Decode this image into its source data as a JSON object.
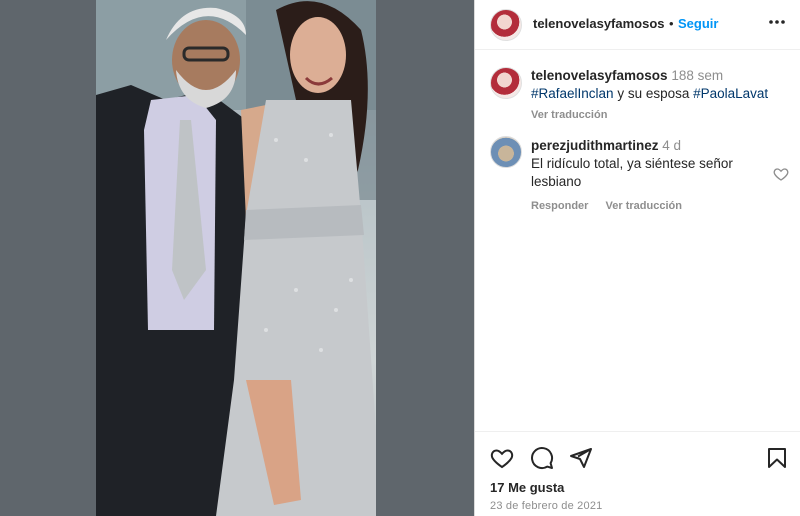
{
  "post": {
    "image_alt": "",
    "likes": "17 Me gusta",
    "date": "23 de febrero de 2021"
  },
  "header": {
    "username": "telenovelasyfamosos",
    "separator": "•",
    "follow_label": "Seguir",
    "more_icon": "more-horizontal-icon"
  },
  "caption": {
    "username": "telenovelasyfamosos",
    "time": "188 sem",
    "tag1": "#RafaelInclan",
    "middle_text": " y su esposa ",
    "tag2": "#PaolaLavat",
    "translate_label": "Ver traducción"
  },
  "comments": [
    {
      "username": "perezjudithmartinez",
      "time": "4 d",
      "text": "El ridículo total, ya siéntese señor lesbiano",
      "reply_label": "Responder",
      "translate_label": "Ver traducción"
    }
  ],
  "actions": {
    "like_icon": "heart-icon",
    "comment_icon": "comment-icon",
    "share_icon": "send-icon",
    "save_icon": "bookmark-icon"
  },
  "colors": {
    "accent": "#0095f6",
    "hashtag": "#00376b",
    "muted": "#8e8e8e"
  }
}
